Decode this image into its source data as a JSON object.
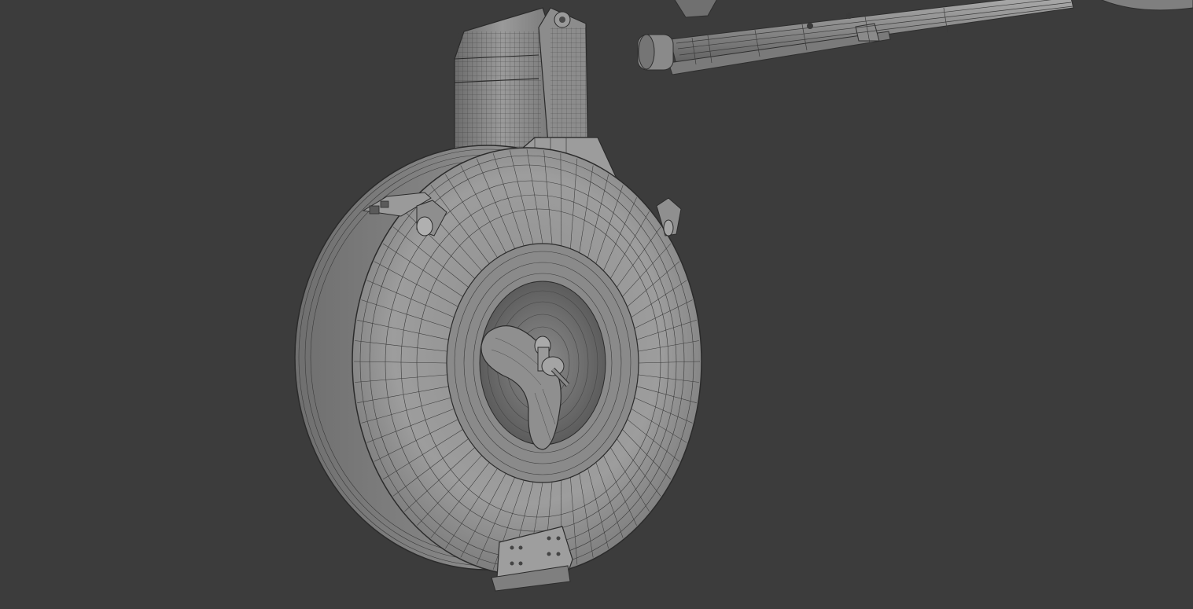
{
  "viewport": {
    "background_color": "#3c3c3c",
    "mesh_fill_color": "#8a8a8a",
    "mesh_light_color": "#a8a8a8",
    "mesh_dark_color": "#5e5e5e",
    "wire_color": "#2a2a2a"
  },
  "scene": {
    "objects": [
      "drum-magazine",
      "magazine-feed-tower",
      "magazine-side-latch-left",
      "magazine-side-latch-right",
      "magazine-center-hub",
      "magazine-winding-key",
      "magazine-bottom-bracket",
      "weapon-barrel"
    ]
  }
}
